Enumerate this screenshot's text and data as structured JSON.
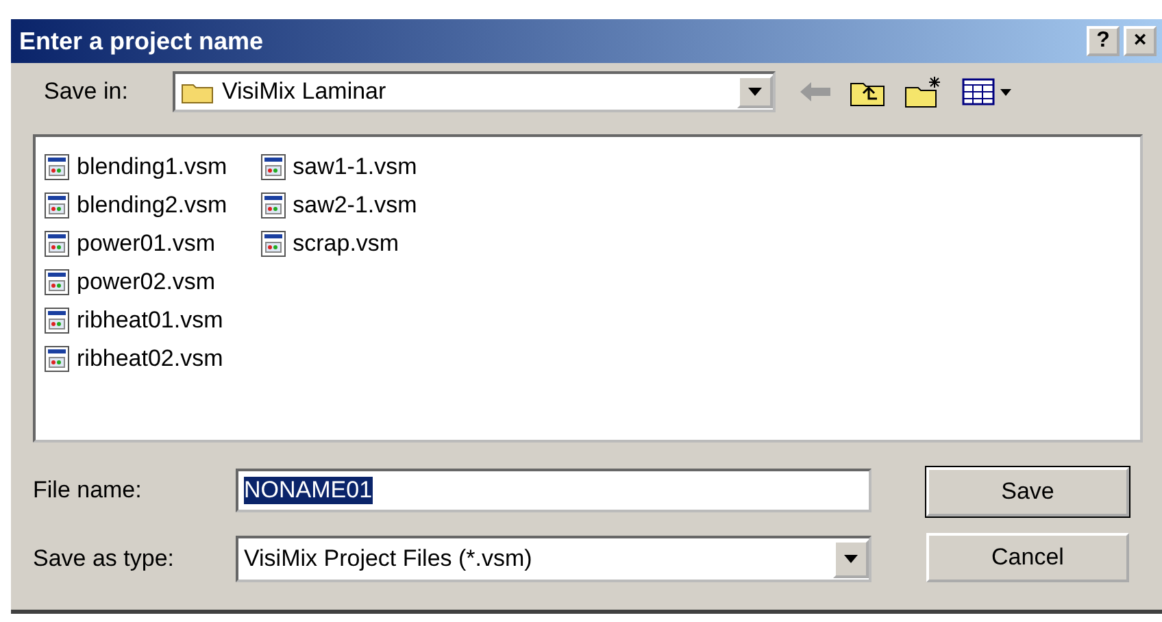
{
  "window": {
    "title": "Enter a project name",
    "buttons": [
      "?",
      "×"
    ]
  },
  "save_in": {
    "label": "Save in:",
    "value": "VisiMix Laminar"
  },
  "files": [
    {
      "name": "blending1.vsm",
      "selected": false
    },
    {
      "name": "blending2.vsm",
      "selected": false
    },
    {
      "name": "power01.vsm",
      "selected": false
    },
    {
      "name": "power02.vsm",
      "selected": false
    },
    {
      "name": "ribheat01.vsm",
      "selected": false
    },
    {
      "name": "ribheat02.vsm",
      "selected": false
    },
    {
      "name": "saw1-1.vsm",
      "selected": false
    },
    {
      "name": "saw2-1.vsm",
      "selected": false
    },
    {
      "name": "scrap.vsm",
      "selected": false
    }
  ],
  "file_name": {
    "label": "File name:",
    "value": "NONAME01",
    "value_selected": true
  },
  "save_as_type": {
    "label": "Save as type:",
    "value": "VisiMix Project Files (*.vsm)"
  },
  "buttons": [
    {
      "label": "Save",
      "default": true
    },
    {
      "label": "Cancel",
      "default": false
    }
  ]
}
